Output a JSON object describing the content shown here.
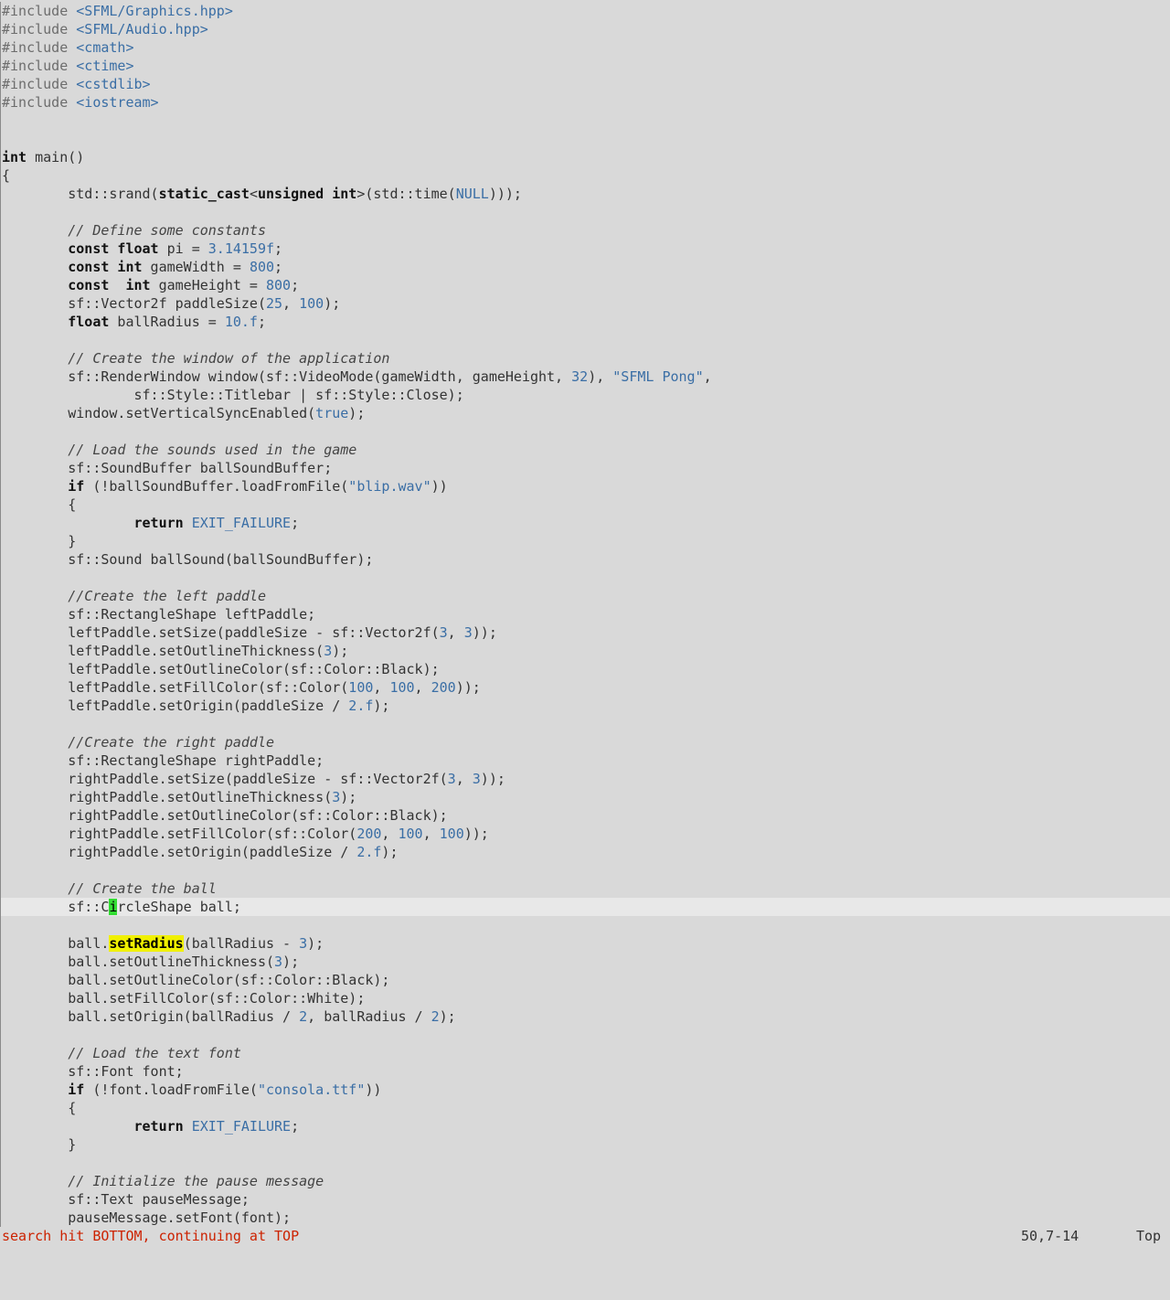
{
  "editor": {
    "lines": [
      [
        {
          "t": "pre",
          "v": "#include "
        },
        {
          "t": "inc",
          "v": "<SFML/Graphics.hpp>"
        }
      ],
      [
        {
          "t": "pre",
          "v": "#include "
        },
        {
          "t": "inc",
          "v": "<SFML/Audio.hpp>"
        }
      ],
      [
        {
          "t": "pre",
          "v": "#include "
        },
        {
          "t": "inc",
          "v": "<cmath>"
        }
      ],
      [
        {
          "t": "pre",
          "v": "#include "
        },
        {
          "t": "inc",
          "v": "<ctime>"
        }
      ],
      [
        {
          "t": "pre",
          "v": "#include "
        },
        {
          "t": "inc",
          "v": "<cstdlib>"
        }
      ],
      [
        {
          "t": "pre",
          "v": "#include "
        },
        {
          "t": "inc",
          "v": "<iostream>"
        }
      ],
      [],
      [],
      [
        {
          "t": "kw",
          "v": "int"
        },
        {
          "t": "n",
          "v": " main()"
        }
      ],
      [
        {
          "t": "n",
          "v": "{"
        }
      ],
      [
        {
          "t": "n",
          "v": "        std::srand("
        },
        {
          "t": "kw",
          "v": "static_cast"
        },
        {
          "t": "n",
          "v": "<"
        },
        {
          "t": "kw",
          "v": "unsigned int"
        },
        {
          "t": "n",
          "v": ">(std::time("
        },
        {
          "t": "const",
          "v": "NULL"
        },
        {
          "t": "n",
          "v": ")));"
        }
      ],
      [],
      [
        {
          "t": "cmt",
          "v": "        // Define some constants"
        }
      ],
      [
        {
          "t": "kw",
          "v": "        const float"
        },
        {
          "t": "n",
          "v": " pi = "
        },
        {
          "t": "num",
          "v": "3.14159f"
        },
        {
          "t": "n",
          "v": ";"
        }
      ],
      [
        {
          "t": "kw",
          "v": "        const int"
        },
        {
          "t": "n",
          "v": " gameWidth = "
        },
        {
          "t": "num",
          "v": "800"
        },
        {
          "t": "n",
          "v": ";"
        }
      ],
      [
        {
          "t": "kw",
          "v": "        const  int"
        },
        {
          "t": "n",
          "v": " gameHeight = "
        },
        {
          "t": "num",
          "v": "800"
        },
        {
          "t": "n",
          "v": ";"
        }
      ],
      [
        {
          "t": "n",
          "v": "        sf::Vector2f paddleSize("
        },
        {
          "t": "num",
          "v": "25"
        },
        {
          "t": "n",
          "v": ", "
        },
        {
          "t": "num",
          "v": "100"
        },
        {
          "t": "n",
          "v": ");"
        }
      ],
      [
        {
          "t": "kw",
          "v": "        float"
        },
        {
          "t": "n",
          "v": " ballRadius = "
        },
        {
          "t": "num",
          "v": "10.f"
        },
        {
          "t": "n",
          "v": ";"
        }
      ],
      [],
      [
        {
          "t": "cmt",
          "v": "        // Create the window of the application"
        }
      ],
      [
        {
          "t": "n",
          "v": "        sf::RenderWindow window(sf::VideoMode(gameWidth, gameHeight, "
        },
        {
          "t": "num",
          "v": "32"
        },
        {
          "t": "n",
          "v": "), "
        },
        {
          "t": "str",
          "v": "\"SFML Pong\""
        },
        {
          "t": "n",
          "v": ","
        }
      ],
      [
        {
          "t": "n",
          "v": "                sf::Style::Titlebar | sf::Style::Close);"
        }
      ],
      [
        {
          "t": "n",
          "v": "        window.setVerticalSyncEnabled("
        },
        {
          "t": "const",
          "v": "true"
        },
        {
          "t": "n",
          "v": ");"
        }
      ],
      [],
      [
        {
          "t": "cmt",
          "v": "        // Load the sounds used in the game"
        }
      ],
      [
        {
          "t": "n",
          "v": "        sf::SoundBuffer ballSoundBuffer;"
        }
      ],
      [
        {
          "t": "kw",
          "v": "        if"
        },
        {
          "t": "n",
          "v": " (!ballSoundBuffer.loadFromFile("
        },
        {
          "t": "str",
          "v": "\"blip.wav\""
        },
        {
          "t": "n",
          "v": "))"
        }
      ],
      [
        {
          "t": "n",
          "v": "        {"
        }
      ],
      [
        {
          "t": "kw",
          "v": "                return"
        },
        {
          "t": "n",
          "v": " "
        },
        {
          "t": "const",
          "v": "EXIT_FAILURE"
        },
        {
          "t": "n",
          "v": ";"
        }
      ],
      [
        {
          "t": "n",
          "v": "        }"
        }
      ],
      [
        {
          "t": "n",
          "v": "        sf::Sound ballSound(ballSoundBuffer);"
        }
      ],
      [],
      [
        {
          "t": "cmt",
          "v": "        //Create the left paddle"
        }
      ],
      [
        {
          "t": "n",
          "v": "        sf::RectangleShape leftPaddle;"
        }
      ],
      [
        {
          "t": "n",
          "v": "        leftPaddle.setSize(paddleSize - sf::Vector2f("
        },
        {
          "t": "num",
          "v": "3"
        },
        {
          "t": "n",
          "v": ", "
        },
        {
          "t": "num",
          "v": "3"
        },
        {
          "t": "n",
          "v": "));"
        }
      ],
      [
        {
          "t": "n",
          "v": "        leftPaddle.setOutlineThickness("
        },
        {
          "t": "num",
          "v": "3"
        },
        {
          "t": "n",
          "v": ");"
        }
      ],
      [
        {
          "t": "n",
          "v": "        leftPaddle.setOutlineColor(sf::Color::Black);"
        }
      ],
      [
        {
          "t": "n",
          "v": "        leftPaddle.setFillColor(sf::Color("
        },
        {
          "t": "num",
          "v": "100"
        },
        {
          "t": "n",
          "v": ", "
        },
        {
          "t": "num",
          "v": "100"
        },
        {
          "t": "n",
          "v": ", "
        },
        {
          "t": "num",
          "v": "200"
        },
        {
          "t": "n",
          "v": "));"
        }
      ],
      [
        {
          "t": "n",
          "v": "        leftPaddle.setOrigin(paddleSize / "
        },
        {
          "t": "num",
          "v": "2.f"
        },
        {
          "t": "n",
          "v": ");"
        }
      ],
      [],
      [
        {
          "t": "cmt",
          "v": "        //Create the right paddle"
        }
      ],
      [
        {
          "t": "n",
          "v": "        sf::RectangleShape rightPaddle;"
        }
      ],
      [
        {
          "t": "n",
          "v": "        rightPaddle.setSize(paddleSize - sf::Vector2f("
        },
        {
          "t": "num",
          "v": "3"
        },
        {
          "t": "n",
          "v": ", "
        },
        {
          "t": "num",
          "v": "3"
        },
        {
          "t": "n",
          "v": "));"
        }
      ],
      [
        {
          "t": "n",
          "v": "        rightPaddle.setOutlineThickness("
        },
        {
          "t": "num",
          "v": "3"
        },
        {
          "t": "n",
          "v": ");"
        }
      ],
      [
        {
          "t": "n",
          "v": "        rightPaddle.setOutlineColor(sf::Color::Black);"
        }
      ],
      [
        {
          "t": "n",
          "v": "        rightPaddle.setFillColor(sf::Color("
        },
        {
          "t": "num",
          "v": "200"
        },
        {
          "t": "n",
          "v": ", "
        },
        {
          "t": "num",
          "v": "100"
        },
        {
          "t": "n",
          "v": ", "
        },
        {
          "t": "num",
          "v": "100"
        },
        {
          "t": "n",
          "v": "));"
        }
      ],
      [
        {
          "t": "n",
          "v": "        rightPaddle.setOrigin(paddleSize / "
        },
        {
          "t": "num",
          "v": "2.f"
        },
        {
          "t": "n",
          "v": ");"
        }
      ],
      [],
      [
        {
          "t": "cmt",
          "v": "        // Create the ball"
        }
      ],
      [
        {
          "t": "n",
          "v": "        sf::C"
        },
        {
          "t": "cursor",
          "v": "i"
        },
        {
          "t": "n",
          "v": "rcleShape ball;"
        }
      ],
      [],
      [
        {
          "t": "n",
          "v": "        ball."
        },
        {
          "t": "search",
          "v": "setRadius"
        },
        {
          "t": "n",
          "v": "(ballRadius - "
        },
        {
          "t": "num",
          "v": "3"
        },
        {
          "t": "n",
          "v": ");"
        }
      ],
      [
        {
          "t": "n",
          "v": "        ball.setOutlineThickness("
        },
        {
          "t": "num",
          "v": "3"
        },
        {
          "t": "n",
          "v": ");"
        }
      ],
      [
        {
          "t": "n",
          "v": "        ball.setOutlineColor(sf::Color::Black);"
        }
      ],
      [
        {
          "t": "n",
          "v": "        ball.setFillColor(sf::Color::White);"
        }
      ],
      [
        {
          "t": "n",
          "v": "        ball.setOrigin(ballRadius / "
        },
        {
          "t": "num",
          "v": "2"
        },
        {
          "t": "n",
          "v": ", ballRadius / "
        },
        {
          "t": "num",
          "v": "2"
        },
        {
          "t": "n",
          "v": ");"
        }
      ],
      [],
      [
        {
          "t": "cmt",
          "v": "        // Load the text font"
        }
      ],
      [
        {
          "t": "n",
          "v": "        sf::Font font;"
        }
      ],
      [
        {
          "t": "kw",
          "v": "        if"
        },
        {
          "t": "n",
          "v": " (!font.loadFromFile("
        },
        {
          "t": "str",
          "v": "\"consola.ttf\""
        },
        {
          "t": "n",
          "v": "))"
        }
      ],
      [
        {
          "t": "n",
          "v": "        {"
        }
      ],
      [
        {
          "t": "kw",
          "v": "                return"
        },
        {
          "t": "n",
          "v": " "
        },
        {
          "t": "const",
          "v": "EXIT_FAILURE"
        },
        {
          "t": "n",
          "v": ";"
        }
      ],
      [
        {
          "t": "n",
          "v": "        }"
        }
      ],
      [],
      [
        {
          "t": "cmt",
          "v": "        // Initialize the pause message"
        }
      ],
      [
        {
          "t": "n",
          "v": "        sf::Text pauseMessage;"
        }
      ],
      [
        {
          "t": "n",
          "v": "        pauseMessage.setFont(font);"
        }
      ]
    ],
    "cursor_line": 50,
    "cursor_col": "7-14",
    "search_term": "setRadius"
  },
  "statusbar": {
    "message": "search hit BOTTOM, continuing at TOP",
    "position": "50,7-14",
    "scroll": "Top"
  },
  "colors": {
    "background": "#d9d9d9",
    "search_highlight": "#f0f000",
    "cursor": "#33dd33",
    "status_message": "#cc2200"
  }
}
